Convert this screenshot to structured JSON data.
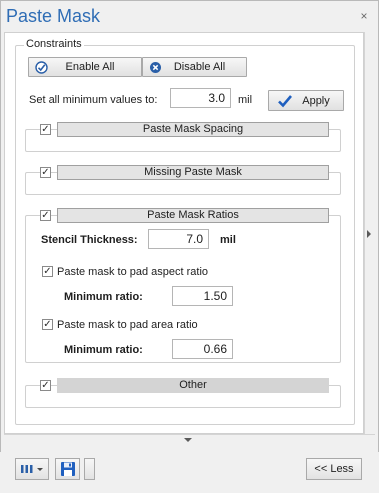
{
  "panel": {
    "title": "Paste Mask",
    "close_glyph": "×"
  },
  "constraints": {
    "legend": "Constraints",
    "enable_all": "Enable All",
    "disable_all": "Disable All",
    "set_all_label": "Set all minimum values to:",
    "set_all_value": "3.0",
    "unit": "mil",
    "apply": "Apply"
  },
  "sections": {
    "spacing": {
      "label": "Paste Mask Spacing",
      "checked": true
    },
    "missing": {
      "label": "Missing Paste Mask",
      "checked": true
    },
    "ratios": {
      "label": "Paste Mask Ratios",
      "checked": true,
      "stencil_label": "Stencil Thickness:",
      "stencil_value": "7.0",
      "stencil_unit": "mil",
      "aspect_label": "Paste mask to pad aspect ratio",
      "aspect_checked": true,
      "aspect_min_label": "Minimum ratio:",
      "aspect_min_value": "1.50",
      "area_label": "Paste mask to pad area ratio",
      "area_checked": true,
      "area_min_label": "Minimum ratio:",
      "area_min_value": "0.66"
    },
    "other": {
      "label": "Other",
      "checked": true
    }
  },
  "footer": {
    "less_button": "<< Less"
  },
  "icons": {
    "enable": "check-circle-icon",
    "disable": "x-circle-icon",
    "apply": "checkmark-icon",
    "columns": "columns-icon",
    "save": "floppy-disk-icon"
  },
  "colors": {
    "title": "#2f6db5",
    "check": "#1f5fbf"
  }
}
